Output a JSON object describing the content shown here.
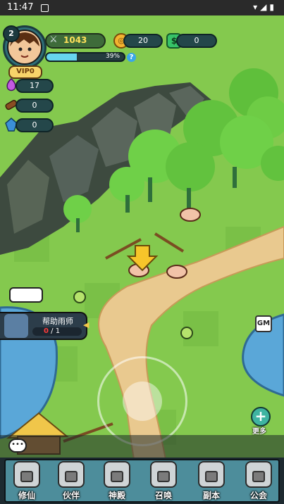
{
  "status_bar": {
    "time": "11:47"
  },
  "player": {
    "level": "2",
    "vip": "VIP0",
    "power": "1043",
    "exp_percent": 39,
    "exp_text": "39%",
    "help": "?"
  },
  "currencies": {
    "coins": "20",
    "jade": "0"
  },
  "resources": [
    {
      "name": "spirit-icon",
      "value": "17",
      "color": "#c35ae0"
    },
    {
      "name": "wood-icon",
      "value": "0",
      "color": "#8a4d23"
    },
    {
      "name": "crystal-icon",
      "value": "0",
      "color": "#3b8fd8"
    }
  ],
  "quest": {
    "title": "帮助雨师",
    "current": "0",
    "total": "1"
  },
  "buttons": {
    "gm": "GM",
    "more": "更多",
    "chat": "•••"
  },
  "nav": [
    {
      "id": "cultivate",
      "label": "修仙"
    },
    {
      "id": "partner",
      "label": "伙伴"
    },
    {
      "id": "temple",
      "label": "神殿"
    },
    {
      "id": "summon",
      "label": "召唤"
    },
    {
      "id": "dungeon",
      "label": "副本"
    },
    {
      "id": "guild",
      "label": "公会"
    }
  ],
  "colors": {
    "grass": "#7cc24a",
    "path": "#e9c98f",
    "water": "#5aa7d8",
    "arrow": "#f7c52a"
  }
}
